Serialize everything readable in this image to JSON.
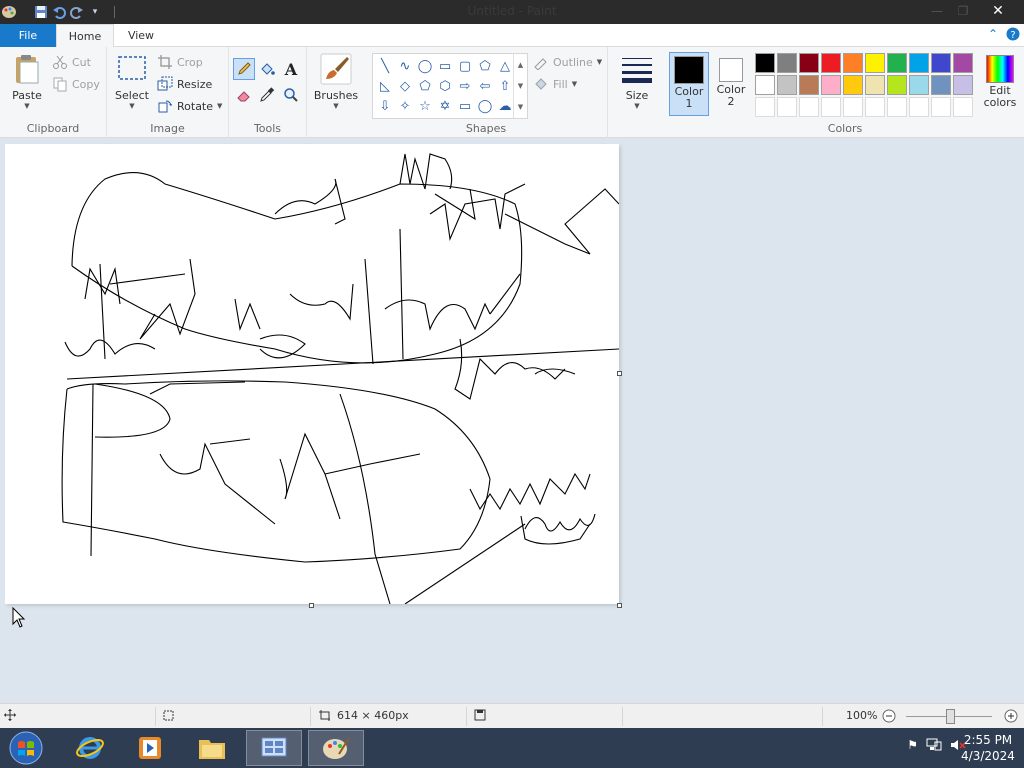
{
  "window": {
    "title": "Untitled - Paint",
    "minimize": "—",
    "maximize": "❐",
    "close": "✕"
  },
  "tabs": [
    {
      "label": "File"
    },
    {
      "label": "Home"
    },
    {
      "label": "View"
    }
  ],
  "clipboard": {
    "group": "Clipboard",
    "paste": "Paste",
    "cut": "Cut",
    "copy": "Copy"
  },
  "image": {
    "group": "Image",
    "select": "Select",
    "crop": "Crop",
    "resize": "Resize",
    "rotate": "Rotate"
  },
  "tools": {
    "group": "Tools",
    "text_glyph": "A"
  },
  "brushes": {
    "label": "Brushes"
  },
  "shapes": {
    "group": "Shapes",
    "outline": "Outline",
    "fill": "Fill"
  },
  "size": {
    "label": "Size"
  },
  "colors": {
    "group": "Colors",
    "color1": "Color\n1",
    "color1_line1": "Color",
    "color1_line2": "1",
    "color2_line1": "Color",
    "color2_line2": "2",
    "edit_line1": "Edit",
    "edit_line2": "colors",
    "color1_value": "#000000",
    "color2_value": "#ffffff",
    "palette_row1": [
      "#000000",
      "#7f7f7f",
      "#880015",
      "#ed1c24",
      "#ff7f27",
      "#fff200",
      "#22b14c",
      "#00a2e8",
      "#3f48cc",
      "#a349a4"
    ],
    "palette_row2": [
      "#ffffff",
      "#c3c3c3",
      "#b97a57",
      "#ffaec9",
      "#ffc90e",
      "#efe4b0",
      "#b5e61d",
      "#99d9ea",
      "#7092be",
      "#c8bfe7"
    ]
  },
  "status": {
    "dimensions": "614 × 460px",
    "zoom": "100%"
  },
  "clock": {
    "time": "2:55 PM",
    "date": "4/3/2024"
  }
}
